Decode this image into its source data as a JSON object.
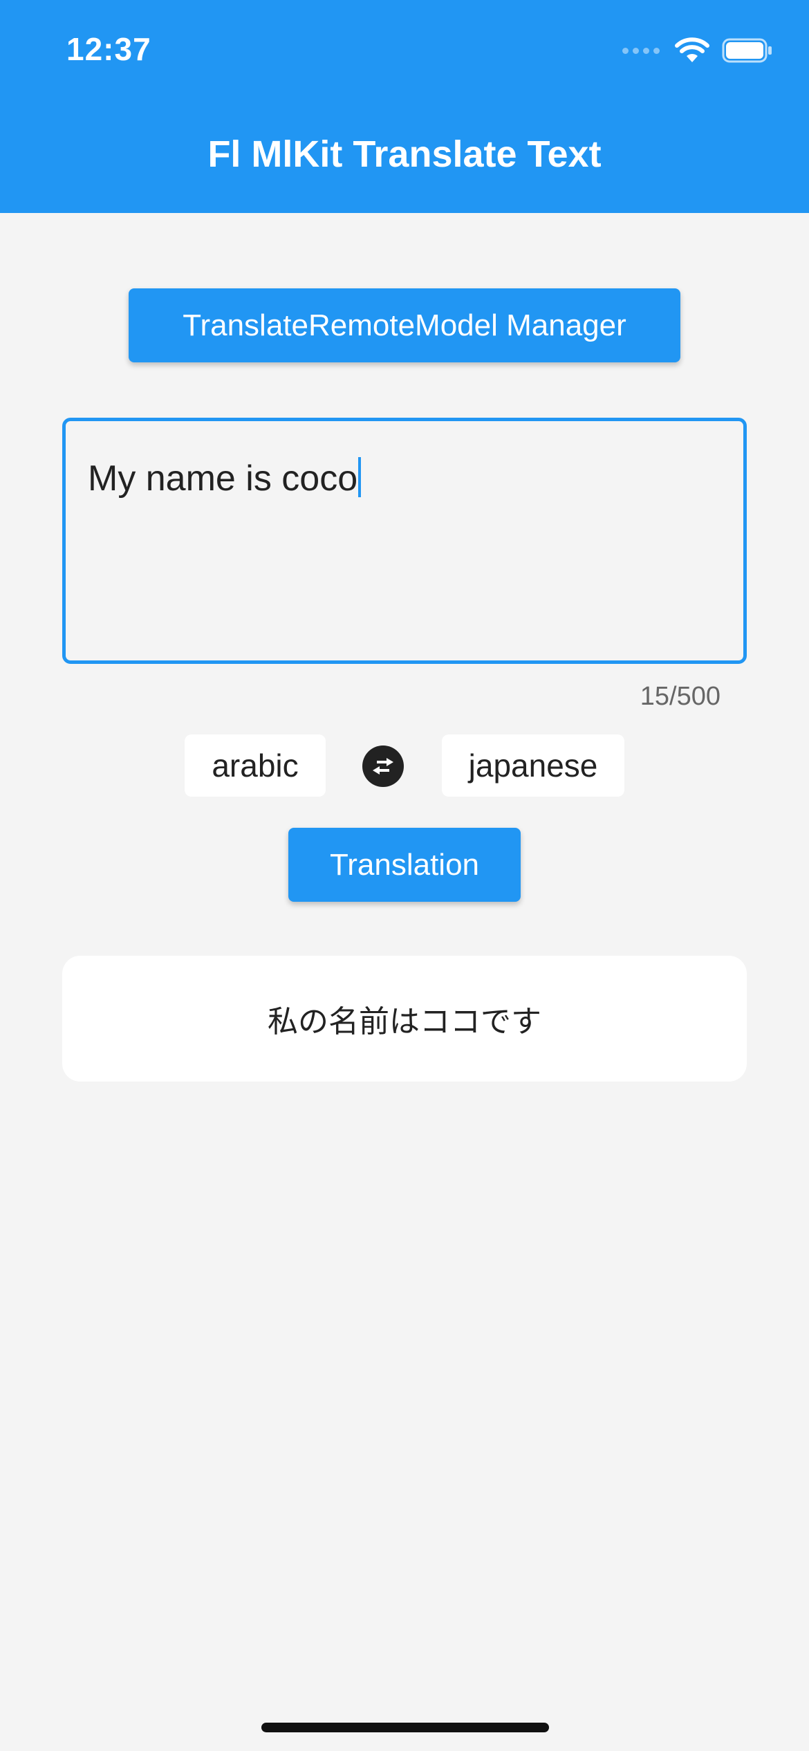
{
  "status_bar": {
    "time": "12:37",
    "icons": [
      "signal-dots-icon",
      "wifi-icon",
      "battery-icon"
    ]
  },
  "app_bar": {
    "title": "Fl MlKit Translate Text"
  },
  "manager_button": {
    "label": "TranslateRemoteModel Manager"
  },
  "input": {
    "value": "My name is coco",
    "counter": "15/500"
  },
  "languages": {
    "source": "arabic",
    "target": "japanese",
    "swap_icon": "swap-horizontal-icon"
  },
  "translate_button": {
    "label": "Translation"
  },
  "result": {
    "text": "私の名前はココです"
  },
  "colors": {
    "primary": "#2196f3",
    "background": "#f4f4f4",
    "card": "#ffffff",
    "text": "#222222"
  }
}
